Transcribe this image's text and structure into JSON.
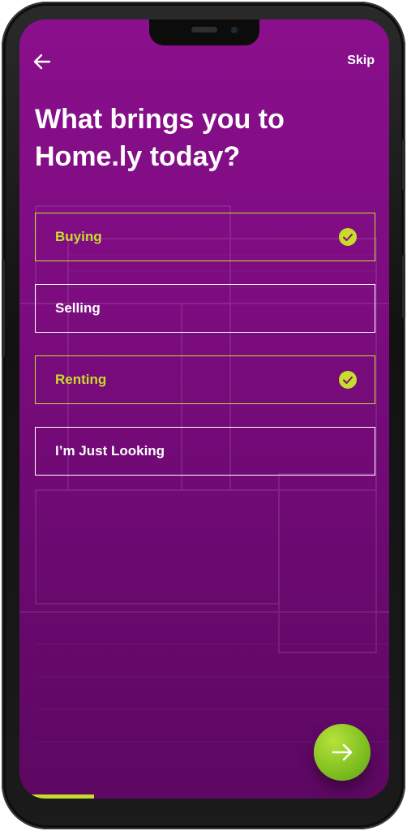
{
  "header": {
    "back_icon": "arrow-left-icon",
    "skip_label": "Skip"
  },
  "title": {
    "line1": "What brings you to",
    "line2": "Home.ly today?"
  },
  "options": [
    {
      "label": "Buying",
      "selected": true
    },
    {
      "label": "Selling",
      "selected": false
    },
    {
      "label": "Renting",
      "selected": true
    },
    {
      "label": "I’m Just Looking",
      "selected": false
    }
  ],
  "next_button": {
    "icon": "arrow-right-icon"
  },
  "progress": {
    "fraction": 0.18
  },
  "colors": {
    "background": "#7d0c80",
    "accent": "#c9dc2c",
    "next_button": "#86c425",
    "text": "#ffffff"
  }
}
